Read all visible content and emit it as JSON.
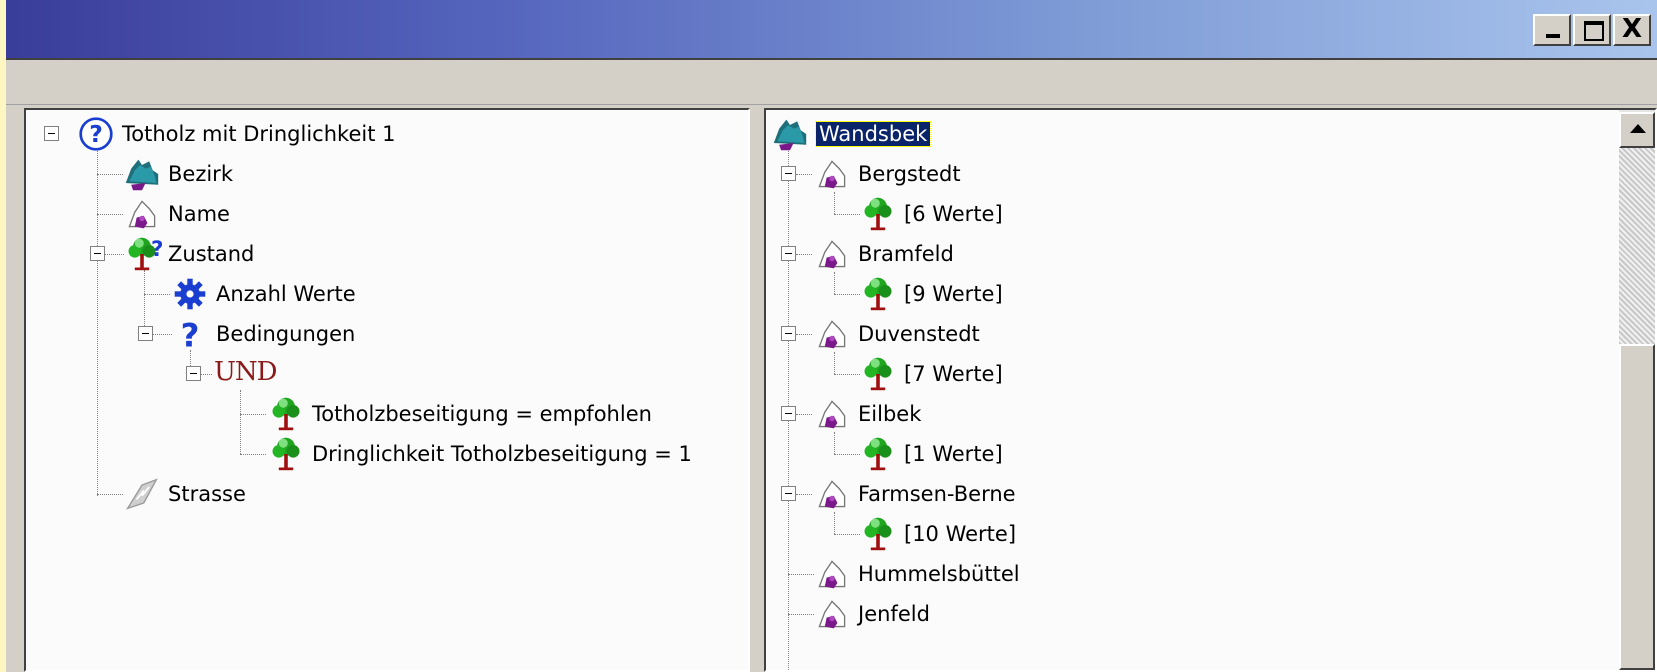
{
  "window": {
    "minimize_label": "_",
    "close_label": "X"
  },
  "left_tree": {
    "root_label": "Totholz mit Dringlichkeit 1",
    "bezirk_label": "Bezirk",
    "name_label": "Name",
    "zustand_label": "Zustand",
    "anzahl_label": "Anzahl Werte",
    "bedingungen_label": "Bedingungen",
    "und_label": "UND",
    "cond1_label": "Totholzbeseitigung = empfohlen",
    "cond2_label": "Dringlichkeit Totholzbeseitigung = 1",
    "strasse_label": "Strasse"
  },
  "right_tree": {
    "root_label": "Wandsbek",
    "items": [
      {
        "label": "Bergstedt",
        "child": "[6 Werte]"
      },
      {
        "label": "Bramfeld",
        "child": "[9 Werte]"
      },
      {
        "label": "Duvenstedt",
        "child": "[7 Werte]"
      },
      {
        "label": "Eilbek",
        "child": "[1 Werte]"
      },
      {
        "label": "Farmsen-Berne",
        "child": "[10 Werte]"
      },
      {
        "label": "Hummelsbüttel"
      },
      {
        "label": "Jenfeld"
      }
    ]
  },
  "icons": {
    "query": "question-circle-icon",
    "bezirk": "district-icon",
    "name": "name-icon",
    "zustand": "tree-question-icon",
    "anzahl": "gear-icon",
    "bedingungen": "question-icon",
    "tree": "tree-icon",
    "strasse": "street-icon"
  },
  "colors": {
    "selection": "#0a246a",
    "und": "#8b1a1a",
    "title_start": "#3a3d9a",
    "title_end": "#a9c4ec"
  }
}
